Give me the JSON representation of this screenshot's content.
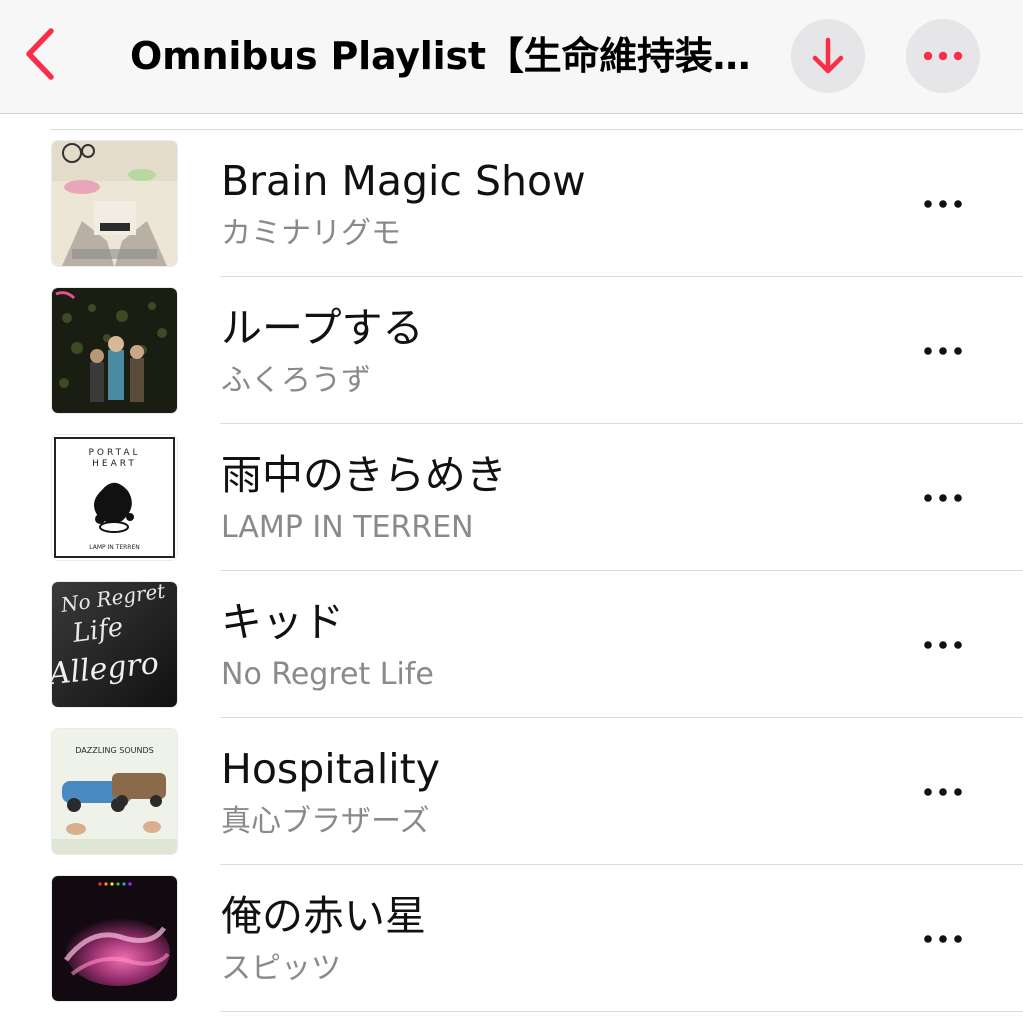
{
  "header": {
    "title": "Omnibus Playlist【生命維持装…",
    "back_icon": "chevron-left-icon",
    "download_icon": "arrow-down-icon",
    "more_icon": "ellipsis-icon",
    "accent_color": "#fa2d48"
  },
  "tracks": [
    {
      "title": "Brain Magic Show",
      "artist": "カミナリグモ",
      "artwork": "album-art"
    },
    {
      "title": "ループする",
      "artist": "ふくろうず",
      "artwork": "album-art"
    },
    {
      "title": "雨中のきらめき",
      "artist": "LAMP IN TERREN",
      "artwork": "album-art",
      "artwork_text": [
        "PORTAL",
        "HEART",
        "LAMP IN TERREN"
      ]
    },
    {
      "title": "キッド",
      "artist": "No Regret Life",
      "artwork": "album-art",
      "artwork_text": [
        "No Regret",
        "Life",
        "Allegro"
      ]
    },
    {
      "title": "Hospitality",
      "artist": "真心ブラザーズ",
      "artwork": "album-art",
      "artwork_text": [
        "DAZZLING SOUNDS"
      ]
    },
    {
      "title": "俺の赤い星",
      "artist": "スピッツ",
      "artwork": "album-art"
    }
  ]
}
